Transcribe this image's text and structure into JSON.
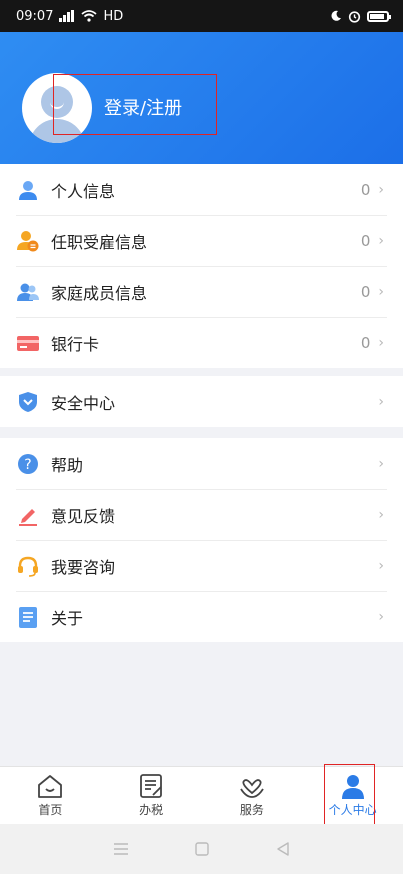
{
  "status_bar": {
    "time": "09:07",
    "network": "HD"
  },
  "header": {
    "login_label": "登录/注册"
  },
  "groups": [
    [
      {
        "label": "个人信息",
        "count": "0",
        "icon": "person-icon"
      },
      {
        "label": "任职受雇信息",
        "count": "0",
        "icon": "employee-icon"
      },
      {
        "label": "家庭成员信息",
        "count": "0",
        "icon": "family-icon"
      },
      {
        "label": "银行卡",
        "count": "0",
        "icon": "bank-card-icon"
      }
    ],
    [
      {
        "label": "安全中心",
        "icon": "shield-icon"
      }
    ],
    [
      {
        "label": "帮助",
        "icon": "help-icon"
      },
      {
        "label": "意见反馈",
        "icon": "feedback-pen-icon"
      },
      {
        "label": "我要咨询",
        "icon": "headset-icon"
      },
      {
        "label": "关于",
        "icon": "document-icon"
      }
    ]
  ],
  "bottom_nav": [
    {
      "label": "首页",
      "icon": "home-icon"
    },
    {
      "label": "办税",
      "icon": "tax-form-icon"
    },
    {
      "label": "服务",
      "icon": "service-heart-icon"
    },
    {
      "label": "个人中心",
      "icon": "person-center-icon",
      "active": true
    }
  ],
  "colors": {
    "accent": "#2b7be6",
    "header_start": "#2f8df2",
    "header_end": "#1c6fe8",
    "highlight": "#e02424"
  }
}
